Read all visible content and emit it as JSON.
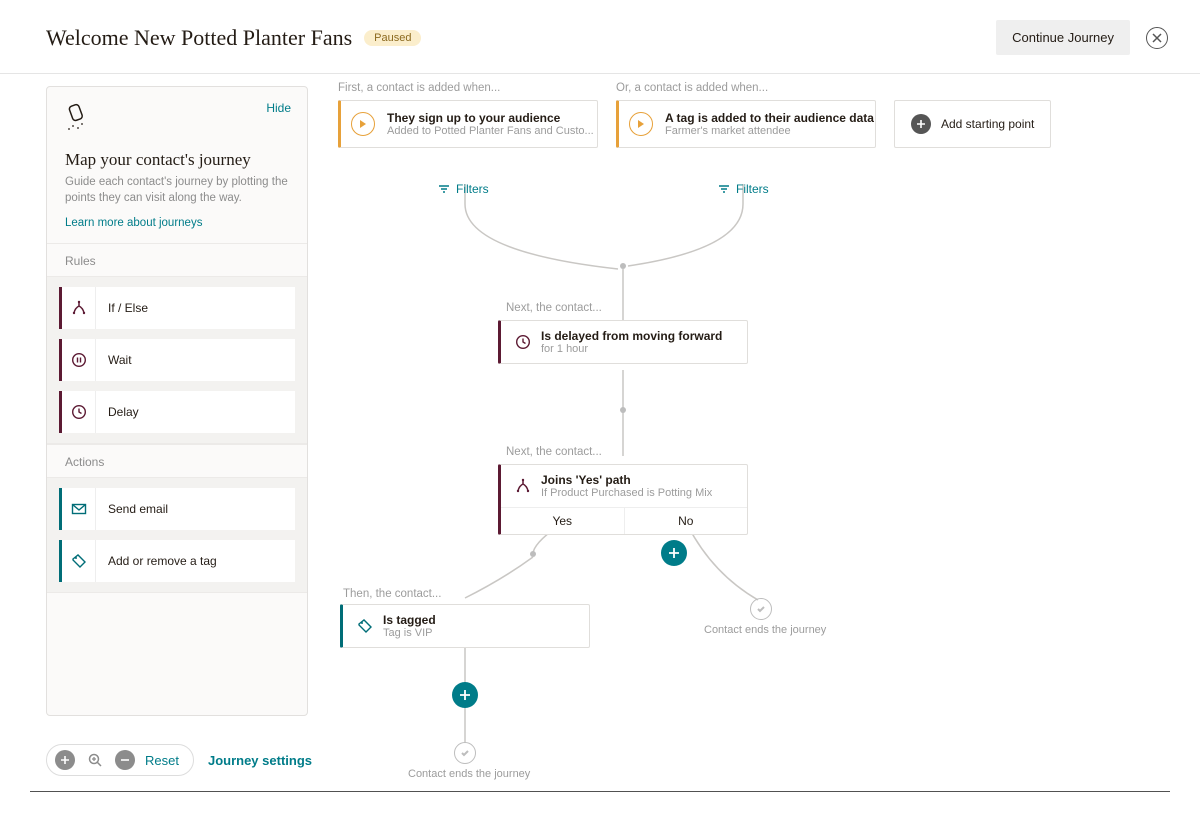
{
  "header": {
    "title": "Welcome New Potted Planter Fans",
    "status": "Paused",
    "continue": "Continue Journey"
  },
  "sidebar": {
    "hide": "Hide",
    "heading": "Map your contact's journey",
    "desc": "Guide each contact's journey by plotting the points they can visit along the way.",
    "learn": "Learn more about journeys",
    "rules_label": "Rules",
    "actions_label": "Actions",
    "rules": [
      {
        "label": "If / Else"
      },
      {
        "label": "Wait"
      },
      {
        "label": "Delay"
      }
    ],
    "actions": [
      {
        "label": "Send email"
      },
      {
        "label": "Add or remove a tag"
      }
    ]
  },
  "toolbar": {
    "reset": "Reset",
    "settings": "Journey settings"
  },
  "canvas": {
    "caption_first": "First, a contact is added when...",
    "caption_or": "Or, a contact is added when...",
    "filters": "Filters",
    "add_start": "Add starting point",
    "start1": {
      "title": "They sign up to your audience",
      "sub": "Added to Potted Planter Fans and Custo..."
    },
    "start2": {
      "title": "A tag is added to their audience data",
      "sub": "Farmer's market attendee"
    },
    "caption_next": "Next, the contact...",
    "delay": {
      "title": "Is delayed from moving forward",
      "sub": "for 1 hour"
    },
    "ifelse": {
      "title": "Joins 'Yes' path",
      "sub": "If Product Purchased is Potting Mix",
      "yes": "Yes",
      "no": "No"
    },
    "caption_then": "Then, the contact...",
    "tag": {
      "title": "Is tagged",
      "sub": "Tag is VIP"
    },
    "end": "Contact ends the journey"
  }
}
